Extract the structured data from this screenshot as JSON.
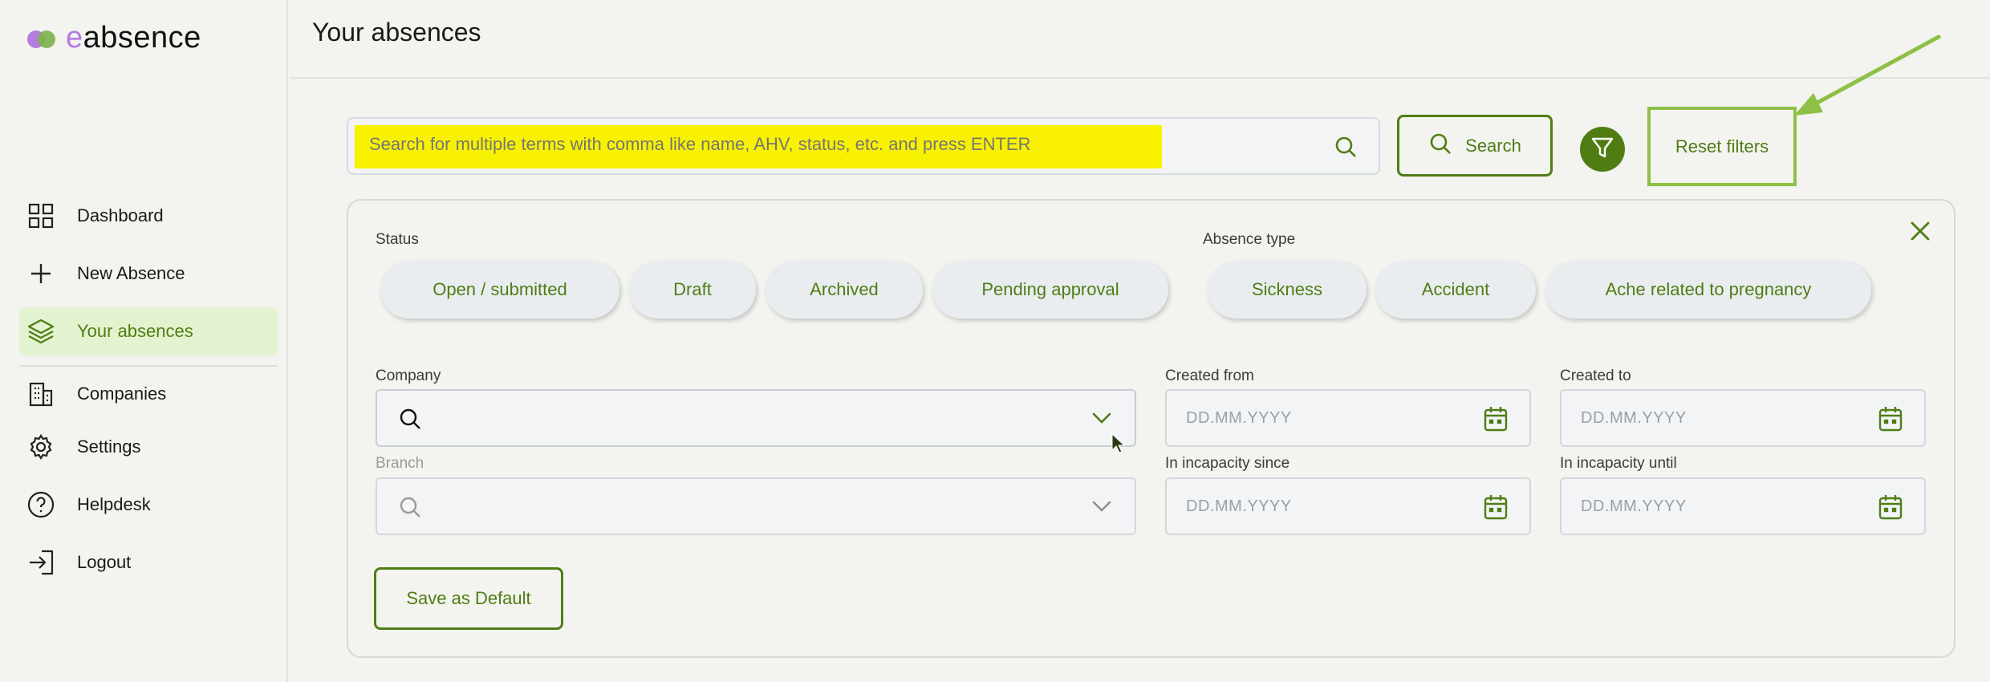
{
  "brand": {
    "prefix": "e",
    "rest": "absence"
  },
  "nav": {
    "items": [
      {
        "label": "Dashboard",
        "icon": "grid-icon"
      },
      {
        "label": "New Absence",
        "icon": "plus-icon"
      },
      {
        "label": "Your absences",
        "icon": "layers-icon",
        "active": true
      },
      {
        "label": "Companies",
        "icon": "building-icon"
      },
      {
        "label": "Settings",
        "icon": "gear-icon"
      },
      {
        "label": "Helpdesk",
        "icon": "help-circle-icon"
      },
      {
        "label": "Logout",
        "icon": "logout-icon"
      }
    ]
  },
  "header": {
    "title": "Your absences"
  },
  "search": {
    "placeholder": "Search for multiple terms with comma like name, AHV, status, etc. and press ENTER",
    "button_label": "Search",
    "reset_label": "Reset filters"
  },
  "filters": {
    "status_label": "Status",
    "status_chips": [
      "Open / submitted",
      "Draft",
      "Archived",
      "Pending approval"
    ],
    "type_label": "Absence type",
    "type_chips": [
      "Sickness",
      "Accident",
      "Ache related to pregnancy"
    ],
    "company_label": "Company",
    "branch_label": "Branch",
    "created_from_label": "Created from",
    "created_to_label": "Created to",
    "incapacity_since_label": "In incapacity since",
    "incapacity_until_label": "In incapacity until",
    "date_placeholder": "DD.MM.YYYY",
    "save_default_label": "Save as Default"
  },
  "colors": {
    "accent": "#4f7d14",
    "highlight": "#f8f200",
    "arrow": "#8dc045",
    "active_bg": "#e3f3cf"
  }
}
